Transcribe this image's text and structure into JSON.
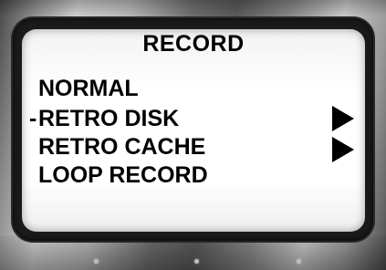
{
  "screen": {
    "title": "RECORD",
    "selected_marker": "-",
    "menu": [
      {
        "label": "NORMAL",
        "selected": false,
        "has_submenu": false
      },
      {
        "label": "RETRO DISK",
        "selected": true,
        "has_submenu": true
      },
      {
        "label": "RETRO CACHE",
        "selected": false,
        "has_submenu": true
      },
      {
        "label": "LOOP RECORD",
        "selected": false,
        "has_submenu": false
      }
    ]
  },
  "icons": {
    "submenu": "triangle-right-icon",
    "indicator": "indicator-light"
  },
  "colors": {
    "screen_background": "#ffffff",
    "text": "#000000",
    "bezel": "#1a1a1a"
  }
}
